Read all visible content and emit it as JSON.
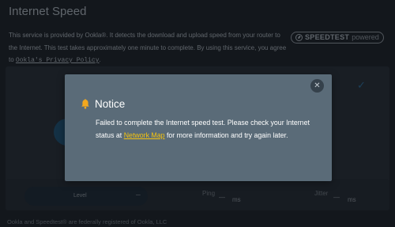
{
  "header": {
    "title": "Internet Speed"
  },
  "description": {
    "text_before_link": "This service is provided by Ookla®. It detects the download and upload speed from your router to the Internet. This test takes approximately one minute to complete. By using this service, you agree to ",
    "link_label": "Ookla's Privacy Policy",
    "text_after_link": "."
  },
  "badge": {
    "brand": "SPEEDTEST",
    "suffix": "powered",
    "icon": "gauge-icon"
  },
  "results": {
    "level_label": "Level",
    "ping_label": "Ping",
    "ping_value": "—",
    "ping_unit": "ms",
    "jitter_label": "Jitter",
    "jitter_value": "—",
    "jitter_unit": "ms"
  },
  "footer": {
    "text": "Ookla and Speedtest® are federally registered of Ookla, LLC"
  },
  "dialog": {
    "title": "Notice",
    "close_glyph": "✕",
    "message_before_link": "Failed to complete the Internet speed test. Please check your Internet status at ",
    "link_label": "Network Map",
    "message_after_link": " for more information and try again later.",
    "icon": "bell-icon",
    "icon_color": "#f3a81e",
    "link_color": "#f3c210"
  },
  "colors": {
    "background": "#1b2026",
    "dialog_background": "#5a6b78",
    "accent": "#2a6a96"
  }
}
